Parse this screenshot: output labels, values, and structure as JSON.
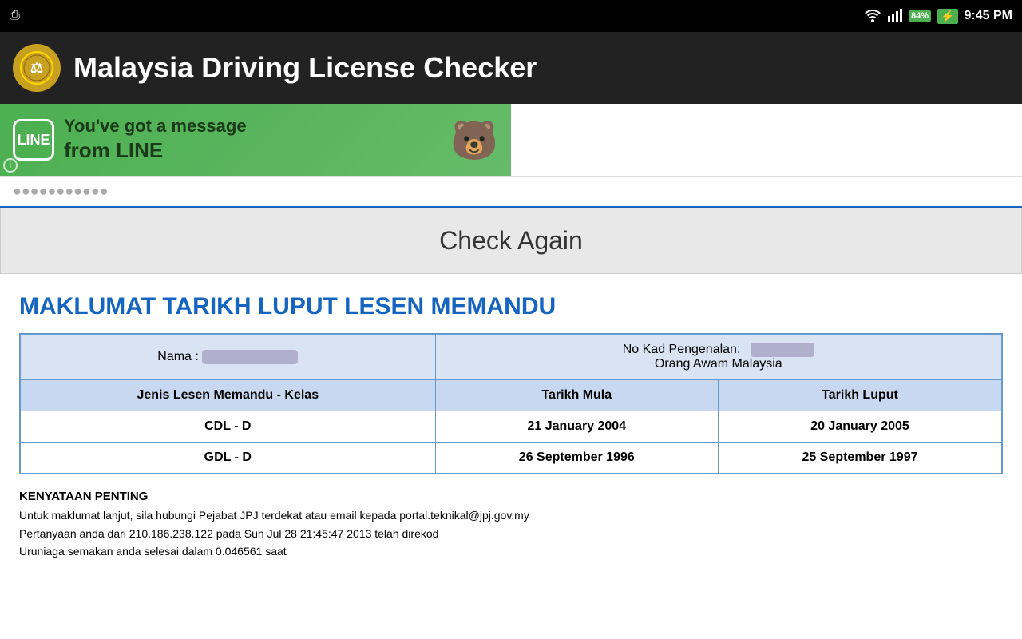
{
  "status_bar": {
    "usb_icon": "⚡",
    "wifi_label": "WiFi",
    "signal_label": "Signal",
    "battery_percent": "84%",
    "time": "9:45 PM"
  },
  "title_bar": {
    "logo_text": "⚖",
    "title": "Malaysia Driving License Checker"
  },
  "ad_banner": {
    "line_logo": "LINE",
    "message": "You've got a message",
    "from_label": "from LINE",
    "info_icon": "i"
  },
  "input_section": {
    "placeholder": "●●●●●●●●●●●"
  },
  "check_again_button": {
    "label": "Check Again"
  },
  "section_heading": "MAKLUMAT TARIKH LUPUT LESEN MEMANDU",
  "table": {
    "label_nama": "Nama :",
    "label_no_kad": "No Kad Pengenalan:",
    "label_orang_awam": "Orang Awam Malaysia",
    "col_jenis": "Jenis Lesen Memandu - Kelas",
    "col_tarikh_mula": "Tarikh Mula",
    "col_tarikh_luput": "Tarikh Luput",
    "rows": [
      {
        "jenis": "CDL - D",
        "tarikh_mula": "21 January 2004",
        "tarikh_luput": "20 January 2005"
      },
      {
        "jenis": "GDL - D",
        "tarikh_mula": "26 September 1996",
        "tarikh_luput": "25 September 1997"
      }
    ]
  },
  "notice": {
    "title": "KENYATAAN PENTING",
    "line1": "Untuk maklumat lanjut, sila hubungi Pejabat JPJ terdekat atau email kepada portal.teknikal@jpj.gov.my",
    "line2": "Pertanyaan anda dari 210.186.238.122 pada Sun Jul 28 21:45:47 2013 telah direkod",
    "line3": "Uruniaga semakan anda selesai dalam 0.046561 saat"
  }
}
